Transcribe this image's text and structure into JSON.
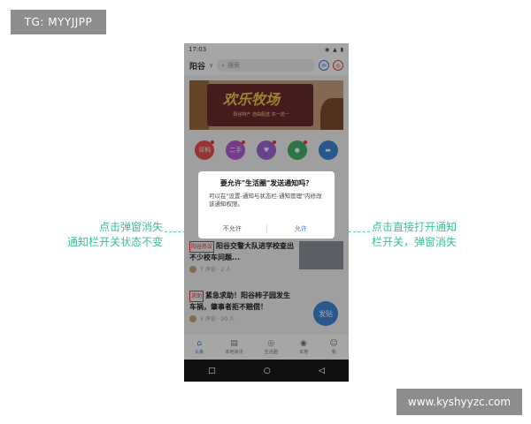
{
  "watermark": {
    "top": "TG: MYYJJPP",
    "bottom": "www.kyshyyzc.com"
  },
  "annotations": {
    "left_line1": "点击弹窗消失",
    "left_line2": "通知栏开关状态不变",
    "right_line1": "点击直接打开通知",
    "right_line2": "栏开关，弹窗消失"
  },
  "colors": {
    "accent": "#3a7bd5",
    "annotation": "#3bbf8f",
    "tag_red": "#d33333"
  },
  "phone": {
    "status": {
      "time": "17:03",
      "icons": "◉ ▲ ▮"
    },
    "app_bar": {
      "city": "阳谷",
      "search_placeholder": "搜索",
      "btn1": "✉",
      "btn2": "◎"
    },
    "banner": {
      "title": "欢乐牧场",
      "subtitle": "阳谷特产 自由配送 买一送一"
    },
    "categories": [
      {
        "label": "评料",
        "color": "#e8504f",
        "icon": "tag-icon"
      },
      {
        "label": "二手",
        "color": "#b45bd6",
        "icon": "secondhand-icon"
      },
      {
        "label": "",
        "color": "#9b69d9",
        "icon": "heart-icon"
      },
      {
        "label": "",
        "color": "#44b36b",
        "icon": "bulb-icon"
      },
      {
        "label": "",
        "color": "#3e86d9",
        "icon": "car-icon"
      }
    ],
    "news": [
      {
        "tag": "阳谷热议",
        "text": "阳谷交警大队进学校查出不少校车问题...",
        "meta": "7 评论 · 2 人"
      },
      {
        "tag": "求助",
        "text": "紧急求助！阳谷柿子园发生车祸，肇事者拒不赔偿！",
        "meta": "5 评论 · 20 人"
      }
    ],
    "fab_label": "发贴",
    "tabs": [
      {
        "label": "头条",
        "icon": "home-icon"
      },
      {
        "label": "本地资讯",
        "icon": "news-icon"
      },
      {
        "label": "生活圈",
        "icon": "circle-icon"
      },
      {
        "label": "本地",
        "icon": "location-icon"
      },
      {
        "label": "我",
        "icon": "user-icon"
      }
    ],
    "nav": {
      "back": "◁",
      "home": "○",
      "recent": "□"
    },
    "dialog": {
      "title": "要允许\"生活圈\"发送通知吗？",
      "body": "可以在\"设置-通知与状态栏-通知管理\"内修改该通知权限。",
      "deny_label": "不允许",
      "allow_label": "允许"
    }
  }
}
